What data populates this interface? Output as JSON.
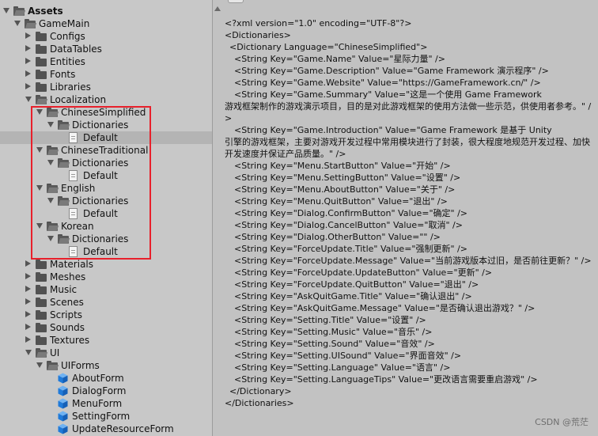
{
  "tree": {
    "items": [
      {
        "label": "Assets",
        "depth": 0,
        "kind": "folder",
        "expanded": true,
        "bold": true
      },
      {
        "label": "GameMain",
        "depth": 1,
        "kind": "folder",
        "expanded": true
      },
      {
        "label": "Configs",
        "depth": 2,
        "kind": "folder",
        "expanded": false
      },
      {
        "label": "DataTables",
        "depth": 2,
        "kind": "folder",
        "expanded": false
      },
      {
        "label": "Entities",
        "depth": 2,
        "kind": "folder",
        "expanded": false
      },
      {
        "label": "Fonts",
        "depth": 2,
        "kind": "folder",
        "expanded": false
      },
      {
        "label": "Libraries",
        "depth": 2,
        "kind": "folder",
        "expanded": false
      },
      {
        "label": "Localization",
        "depth": 2,
        "kind": "folder",
        "expanded": true
      },
      {
        "label": "ChineseSimplified",
        "depth": 3,
        "kind": "folder",
        "expanded": true
      },
      {
        "label": "Dictionaries",
        "depth": 4,
        "kind": "folder",
        "expanded": true
      },
      {
        "label": "Default",
        "depth": 5,
        "kind": "file",
        "selected": true
      },
      {
        "label": "ChineseTraditional",
        "depth": 3,
        "kind": "folder",
        "expanded": true
      },
      {
        "label": "Dictionaries",
        "depth": 4,
        "kind": "folder",
        "expanded": true
      },
      {
        "label": "Default",
        "depth": 5,
        "kind": "file"
      },
      {
        "label": "English",
        "depth": 3,
        "kind": "folder",
        "expanded": true
      },
      {
        "label": "Dictionaries",
        "depth": 4,
        "kind": "folder",
        "expanded": true
      },
      {
        "label": "Default",
        "depth": 5,
        "kind": "file"
      },
      {
        "label": "Korean",
        "depth": 3,
        "kind": "folder",
        "expanded": true
      },
      {
        "label": "Dictionaries",
        "depth": 4,
        "kind": "folder",
        "expanded": true
      },
      {
        "label": "Default",
        "depth": 5,
        "kind": "file"
      },
      {
        "label": "Materials",
        "depth": 2,
        "kind": "folder",
        "expanded": false
      },
      {
        "label": "Meshes",
        "depth": 2,
        "kind": "folder",
        "expanded": false
      },
      {
        "label": "Music",
        "depth": 2,
        "kind": "folder",
        "expanded": false
      },
      {
        "label": "Scenes",
        "depth": 2,
        "kind": "folder",
        "expanded": false
      },
      {
        "label": "Scripts",
        "depth": 2,
        "kind": "folder",
        "expanded": false
      },
      {
        "label": "Sounds",
        "depth": 2,
        "kind": "folder",
        "expanded": false
      },
      {
        "label": "Textures",
        "depth": 2,
        "kind": "folder",
        "expanded": false
      },
      {
        "label": "UI",
        "depth": 2,
        "kind": "folder",
        "expanded": true
      },
      {
        "label": "UIForms",
        "depth": 3,
        "kind": "folder",
        "expanded": true
      },
      {
        "label": "AboutForm",
        "depth": 4,
        "kind": "prefab"
      },
      {
        "label": "DialogForm",
        "depth": 4,
        "kind": "prefab"
      },
      {
        "label": "MenuForm",
        "depth": 4,
        "kind": "prefab"
      },
      {
        "label": "SettingForm",
        "depth": 4,
        "kind": "prefab"
      },
      {
        "label": "UpdateResourceForm",
        "depth": 4,
        "kind": "prefab"
      }
    ]
  },
  "xml_lines": [
    {
      "text": "<?xml version=\"1.0\" encoding=\"UTF-8\"?>",
      "indent": 0
    },
    {
      "text": "<Dictionaries>",
      "indent": 0
    },
    {
      "text": "<Dictionary Language=\"ChineseSimplified\">",
      "indent": 1
    },
    {
      "text": "<String Key=\"Game.Name\" Value=\"星际力量\" />",
      "indent": 2
    },
    {
      "text": "<String Key=\"Game.Description\" Value=\"Game Framework 演示程序\" />",
      "indent": 2
    },
    {
      "text": "<String Key=\"Game.Website\" Value=\"https://GameFramework.cn/\" />",
      "indent": 2
    },
    {
      "text": "<String Key=\"Game.Summary\" Value=\"这是一个使用 Game Framework",
      "indent": 2
    },
    {
      "text": "游戏框架制作的游戏演示项目，目的是对此游戏框架的使用方法做一些示范，供使用者参考。\" />",
      "indent": 0
    },
    {
      "text": "<String Key=\"Game.Introduction\" Value=\"Game Framework 是基于 Unity",
      "indent": 2
    },
    {
      "text": "引擎的游戏框架，主要对游戏开发过程中常用模块进行了封装，很大程度地规范开发过程、加快开发速度并保证产品质量。\" />",
      "indent": 0
    },
    {
      "text": "<String Key=\"Menu.StartButton\" Value=\"开始\" />",
      "indent": 2
    },
    {
      "text": "<String Key=\"Menu.SettingButton\" Value=\"设置\" />",
      "indent": 2
    },
    {
      "text": "<String Key=\"Menu.AboutButton\" Value=\"关于\" />",
      "indent": 2
    },
    {
      "text": "<String Key=\"Menu.QuitButton\" Value=\"退出\" />",
      "indent": 2
    },
    {
      "text": "<String Key=\"Dialog.ConfirmButton\" Value=\"确定\" />",
      "indent": 2
    },
    {
      "text": "<String Key=\"Dialog.CancelButton\" Value=\"取消\" />",
      "indent": 2
    },
    {
      "text": "<String Key=\"Dialog.OtherButton\" Value=\"\" />",
      "indent": 2
    },
    {
      "text": "<String Key=\"ForceUpdate.Title\" Value=\"强制更新\" />",
      "indent": 2
    },
    {
      "text": "<String Key=\"ForceUpdate.Message\" Value=\"当前游戏版本过旧，是否前往更新？\" />",
      "indent": 2
    },
    {
      "text": "<String Key=\"ForceUpdate.UpdateButton\" Value=\"更新\" />",
      "indent": 2
    },
    {
      "text": "<String Key=\"ForceUpdate.QuitButton\" Value=\"退出\" />",
      "indent": 2
    },
    {
      "text": "<String Key=\"AskQuitGame.Title\" Value=\"确认退出\" />",
      "indent": 2
    },
    {
      "text": "<String Key=\"AskQuitGame.Message\" Value=\"是否确认退出游戏？\" />",
      "indent": 2
    },
    {
      "text": "<String Key=\"Setting.Title\" Value=\"设置\" />",
      "indent": 2
    },
    {
      "text": "<String Key=\"Setting.Music\" Value=\"音乐\" />",
      "indent": 2
    },
    {
      "text": "<String Key=\"Setting.Sound\" Value=\"音效\" />",
      "indent": 2
    },
    {
      "text": "<String Key=\"Setting.UISound\" Value=\"界面音效\" />",
      "indent": 2
    },
    {
      "text": "<String Key=\"Setting.Language\" Value=\"语言\" />",
      "indent": 2
    },
    {
      "text": "<String Key=\"Setting.LanguageTips\" Value=\"更改语言需要重启游戏\" />",
      "indent": 2
    },
    {
      "text": "</Dictionary>",
      "indent": 1
    },
    {
      "text": "</Dictionaries>",
      "indent": 0
    }
  ],
  "watermark": "CSDN @荒茫",
  "colors": {
    "highlight_box": "#e8202b",
    "selected_row": "#b4b4b4",
    "panel_bg": "#c8c8c8",
    "prefab_icon": "#1f7ad9"
  }
}
